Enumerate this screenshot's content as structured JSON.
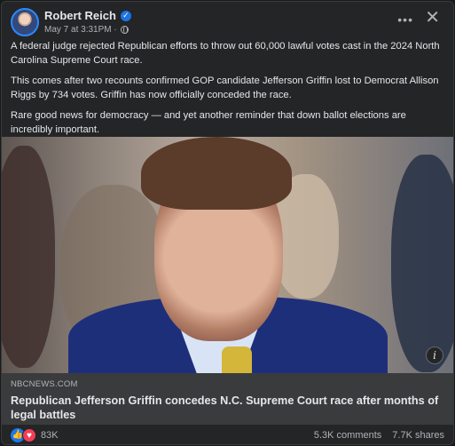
{
  "post": {
    "author": "Robert Reich",
    "verified_icon": "verified-badge-icon",
    "time": "May 7 at 3:31PM ·",
    "audience_icon": "globe-icon",
    "paragraphs": [
      "A federal judge rejected Republican efforts to throw out 60,000 lawful votes cast in the 2024 North Carolina Supreme Court race.",
      "This comes after two recounts confirmed GOP candidate Jefferson Griffin lost to Democrat Allison Riggs by 734 votes. Griffin has now officially conceded the race.",
      "Rare good news for democracy — and yet another reminder that down ballot elections are incredibly important."
    ]
  },
  "actions": {
    "more_icon": "more-options-icon",
    "more_label": "•••",
    "close_icon": "close-icon",
    "close_label": "✕"
  },
  "link": {
    "domain": "NBCNEWS.COM",
    "headline": "Republican Jefferson Griffin concedes N.C. Supreme Court race after months of legal battles",
    "info_label": "i"
  },
  "stats": {
    "reactions_count": "83K",
    "comments": "5.3K comments",
    "shares": "7.7K shares",
    "like_symbol": "👍",
    "love_symbol": "♥"
  },
  "colors": {
    "background": "#18191a",
    "card": "#242526",
    "text": "#e4e6eb",
    "secondary_text": "#b0b3b8",
    "accent_blue": "#1877f2",
    "love_red": "#f33e58"
  }
}
